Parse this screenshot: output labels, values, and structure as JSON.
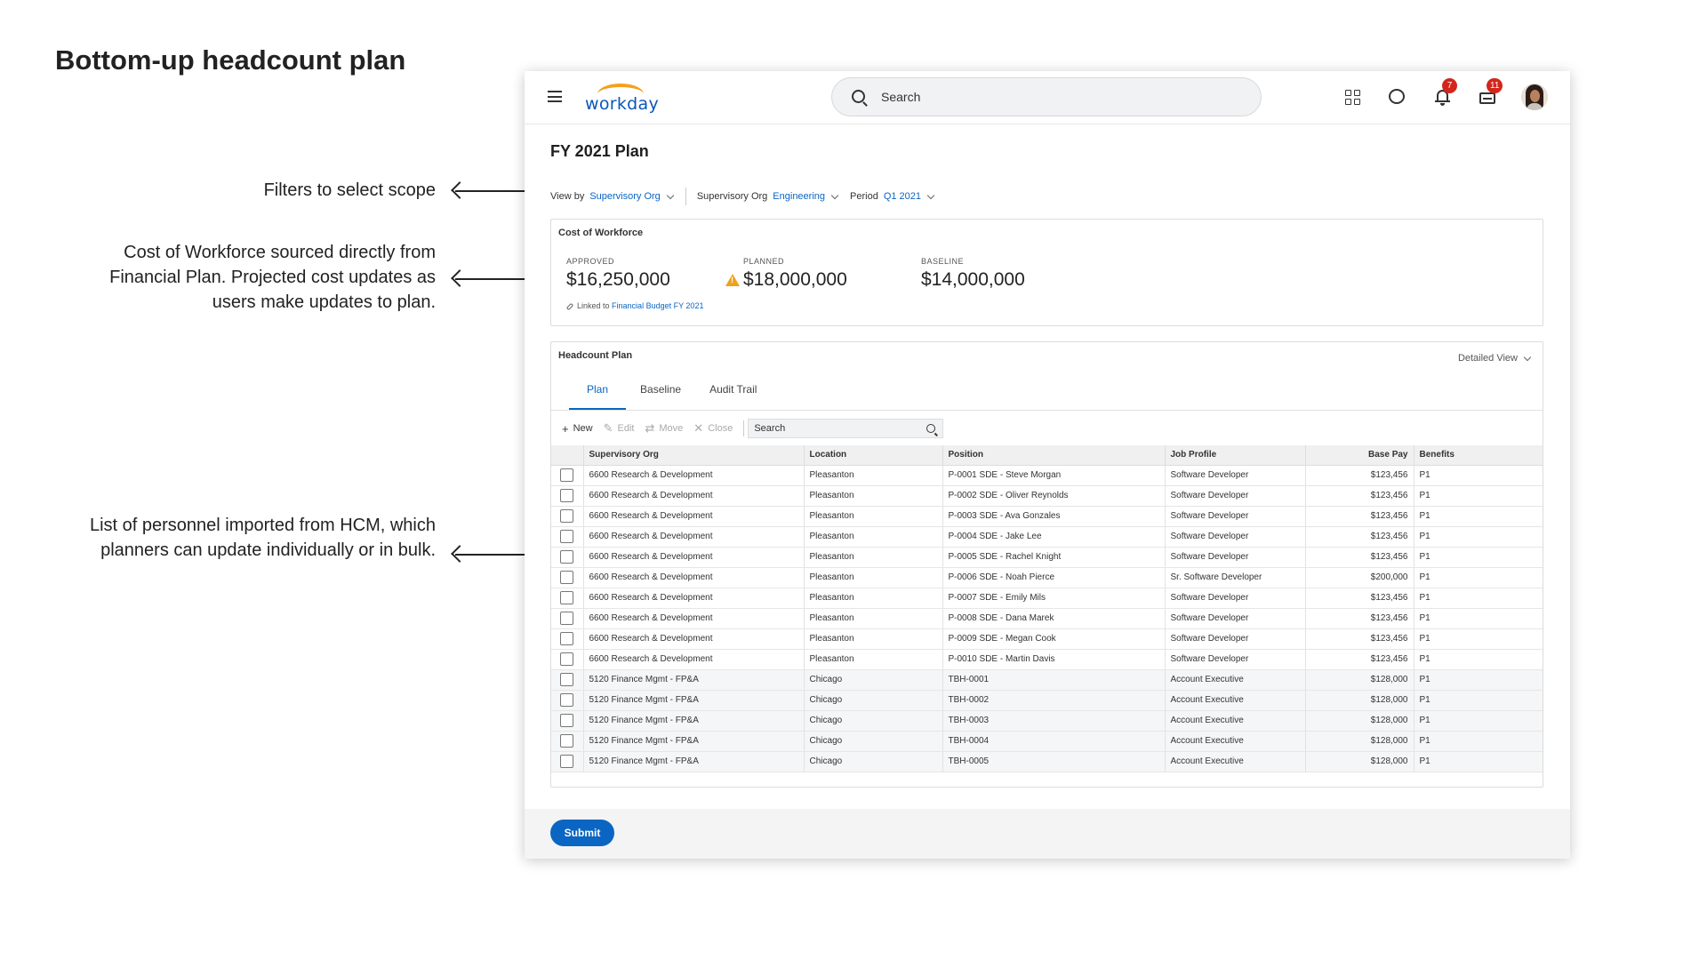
{
  "page_title": "Bottom-up headcount plan",
  "annotations": [
    "Filters to select scope",
    "Cost of Workforce sourced directly from Financial Plan. Projected cost updates as users make updates to plan.",
    "List of personnel imported from HCM, which planners can update individually or in bulk."
  ],
  "app": {
    "logo": "workday",
    "search_placeholder": "Search",
    "notifications_count": "7",
    "inbox_count": "11"
  },
  "plan": {
    "title": "FY 2021 Plan",
    "filters": [
      {
        "label": "View by",
        "value": "Supervisory Org"
      },
      {
        "label": "Supervisory Org",
        "value": "Engineering"
      },
      {
        "label": "Period",
        "value": "Q1 2021"
      }
    ]
  },
  "cost": {
    "title": "Cost of Workforce",
    "approved_label": "APPROVED",
    "approved_value": "$16,250,000",
    "planned_label": "PLANNED",
    "planned_value": "$18,000,000",
    "baseline_label": "BASELINE",
    "baseline_value": "$14,000,000",
    "linked_prefix": "Linked to",
    "linked_link": "Financial Budget FY 2021"
  },
  "headcount": {
    "title": "Headcount Plan",
    "view": "Detailed View",
    "tabs": [
      "Plan",
      "Baseline",
      "Audit Trail"
    ],
    "toolbar": {
      "new": "New",
      "edit": "Edit",
      "move": "Move",
      "close": "Close",
      "search_placeholder": "Search"
    },
    "columns": [
      "Supervisory Org",
      "Location",
      "Position",
      "Job Profile",
      "Base Pay",
      "Benefits"
    ],
    "rows": [
      [
        "6600 Research & Development",
        "Pleasanton",
        "P-0001 SDE - Steve Morgan",
        "Software Developer",
        "$123,456",
        "P1"
      ],
      [
        "6600 Research & Development",
        "Pleasanton",
        "P-0002 SDE - Oliver Reynolds",
        "Software Developer",
        "$123,456",
        "P1"
      ],
      [
        "6600 Research & Development",
        "Pleasanton",
        "P-0003 SDE - Ava Gonzales",
        "Software Developer",
        "$123,456",
        "P1"
      ],
      [
        "6600 Research & Development",
        "Pleasanton",
        "P-0004 SDE - Jake Lee",
        "Software Developer",
        "$123,456",
        "P1"
      ],
      [
        "6600 Research & Development",
        "Pleasanton",
        "P-0005 SDE - Rachel Knight",
        "Software Developer",
        "$123,456",
        "P1"
      ],
      [
        "6600 Research & Development",
        "Pleasanton",
        "P-0006 SDE - Noah Pierce",
        "Sr. Software Developer",
        "$200,000",
        "P1"
      ],
      [
        "6600 Research & Development",
        "Pleasanton",
        "P-0007 SDE - Emily Mils",
        "Software Developer",
        "$123,456",
        "P1"
      ],
      [
        "6600 Research & Development",
        "Pleasanton",
        "P-0008 SDE - Dana Marek",
        "Software Developer",
        "$123,456",
        "P1"
      ],
      [
        "6600 Research & Development",
        "Pleasanton",
        "P-0009 SDE - Megan Cook",
        "Software Developer",
        "$123,456",
        "P1"
      ],
      [
        "6600 Research & Development",
        "Pleasanton",
        "P-0010 SDE - Martin Davis",
        "Software Developer",
        "$123,456",
        "P1"
      ],
      [
        "5120 Finance Mgmt - FP&A",
        "Chicago",
        "TBH-0001",
        "Account Executive",
        "$128,000",
        "P1"
      ],
      [
        "5120 Finance Mgmt - FP&A",
        "Chicago",
        "TBH-0002",
        "Account Executive",
        "$128,000",
        "P1"
      ],
      [
        "5120 Finance Mgmt - FP&A",
        "Chicago",
        "TBH-0003",
        "Account Executive",
        "$128,000",
        "P1"
      ],
      [
        "5120 Finance Mgmt - FP&A",
        "Chicago",
        "TBH-0004",
        "Account Executive",
        "$128,000",
        "P1"
      ],
      [
        "5120 Finance Mgmt - FP&A",
        "Chicago",
        "TBH-0005",
        "Account Executive",
        "$128,000",
        "P1"
      ]
    ]
  },
  "submit_label": "Submit",
  "colors": {
    "accent": "#0b65c2",
    "badge": "#d3261b",
    "warning": "#f0a21b",
    "logo_arc": "#f6a01a"
  }
}
